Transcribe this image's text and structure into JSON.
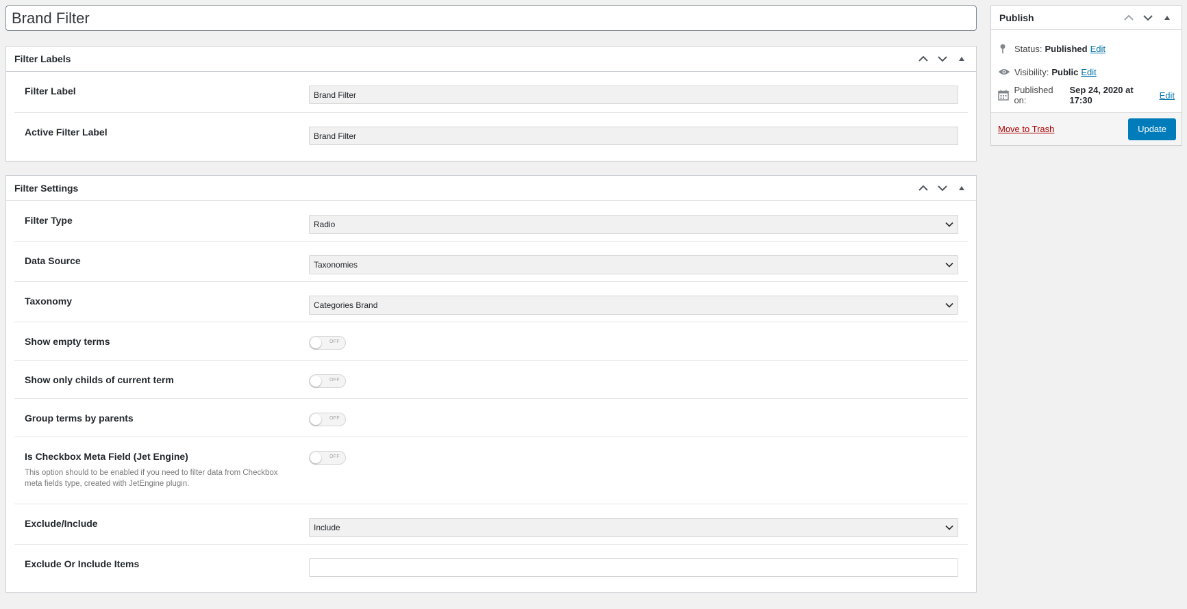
{
  "post_title": "Brand Filter",
  "filter_labels": {
    "title": "Filter Labels",
    "rows": [
      {
        "label": "Filter Label",
        "value": "Brand Filter"
      },
      {
        "label": "Active Filter Label",
        "value": "Brand Filter"
      }
    ]
  },
  "filter_settings": {
    "title": "Filter Settings",
    "filter_type": {
      "label": "Filter Type",
      "value": "Radio"
    },
    "data_source": {
      "label": "Data Source",
      "value": "Taxonomies"
    },
    "taxonomy": {
      "label": "Taxonomy",
      "value": "Categories Brand"
    },
    "show_empty_terms": {
      "label": "Show empty terms",
      "state": "OFF"
    },
    "show_only_childs": {
      "label": "Show only childs of current term",
      "state": "OFF"
    },
    "group_terms": {
      "label": "Group terms by parents",
      "state": "OFF"
    },
    "is_checkbox_meta": {
      "label": "Is Checkbox Meta Field (Jet Engine)",
      "state": "OFF",
      "description": "This option should to be enabled if you need to filter data from Checkbox meta fields type, created with JetEngine plugin."
    },
    "exclude_include": {
      "label": "Exclude/Include",
      "value": "Include"
    },
    "exclude_include_items": {
      "label": "Exclude Or Include Items",
      "value": ""
    }
  },
  "publish": {
    "title": "Publish",
    "status_label": "Status:",
    "status_value": "Published",
    "visibility_label": "Visibility:",
    "visibility_value": "Public",
    "published_label": "Published on:",
    "published_value": "Sep 24, 2020 at 17:30",
    "edit_link": "Edit",
    "trash_link": "Move to Trash",
    "update_button": "Update"
  },
  "icons": {
    "move_up": "chevron-up-icon",
    "move_down": "chevron-down-icon",
    "toggle": "triangle-up-icon",
    "status": "pin-icon",
    "visibility": "eye-icon",
    "date": "calendar-icon",
    "select": "chevron-down-icon"
  },
  "colors": {
    "link": "#0073aa",
    "trash": "#aa0000",
    "primary_button": "#007cba"
  }
}
